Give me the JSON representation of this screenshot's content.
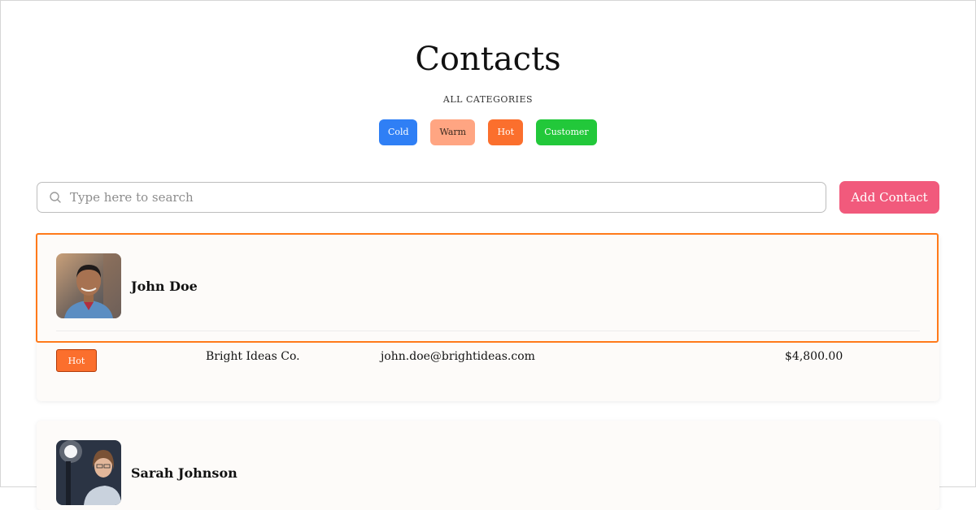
{
  "header": {
    "title": "Contacts",
    "subtitle": "ALL CATEGORIES"
  },
  "categories": [
    {
      "label": "Cold"
    },
    {
      "label": "Warm"
    },
    {
      "label": "Hot"
    },
    {
      "label": "Customer"
    }
  ],
  "search": {
    "placeholder": "Type here to search",
    "value": "",
    "icon": "search-icon"
  },
  "toolbar": {
    "add_label": "Add Contact"
  },
  "contacts": [
    {
      "name": "John Doe",
      "category": "Hot",
      "company": "Bright Ideas Co.",
      "email": "john.doe@brightideas.com",
      "amount": "$4,800.00"
    },
    {
      "name": "Sarah Johnson"
    }
  ],
  "colors": {
    "cold": "#2f7ff5",
    "warm": "#ffa582",
    "hot": "#fb6f2d",
    "customer": "#22c83a",
    "accent": "#f15a7c",
    "highlight": "#ff7a1a"
  }
}
